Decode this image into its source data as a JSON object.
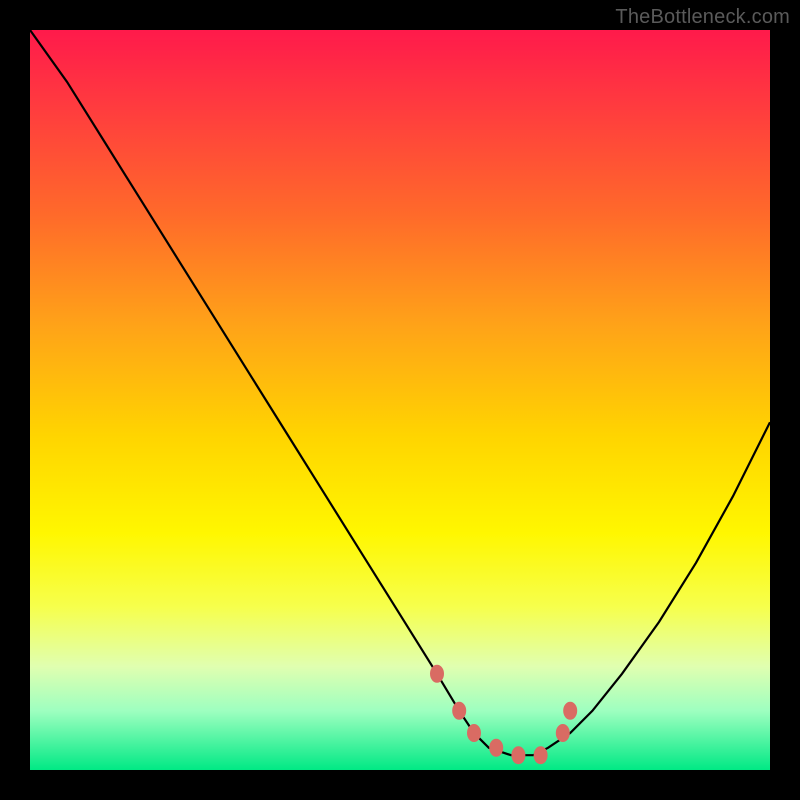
{
  "watermark": "TheBottleneck.com",
  "chart_data": {
    "type": "line",
    "title": "",
    "xlabel": "",
    "ylabel": "",
    "xlim": [
      0,
      100
    ],
    "ylim": [
      0,
      100
    ],
    "series": [
      {
        "name": "bottleneck-curve",
        "x": [
          0,
          5,
          10,
          15,
          20,
          25,
          30,
          35,
          40,
          45,
          50,
          55,
          58,
          60,
          62,
          65,
          68,
          70,
          73,
          76,
          80,
          85,
          90,
          95,
          100
        ],
        "y": [
          100,
          93,
          85,
          77,
          69,
          61,
          53,
          45,
          37,
          29,
          21,
          13,
          8,
          5,
          3,
          2,
          2,
          3,
          5,
          8,
          13,
          20,
          28,
          37,
          47
        ]
      }
    ],
    "markers": {
      "name": "highlight-segment",
      "color": "#d96b63",
      "points_x": [
        55,
        58,
        60,
        63,
        66,
        69,
        72,
        73
      ],
      "points_y": [
        13,
        8,
        5,
        3,
        2,
        2,
        5,
        8
      ]
    }
  }
}
